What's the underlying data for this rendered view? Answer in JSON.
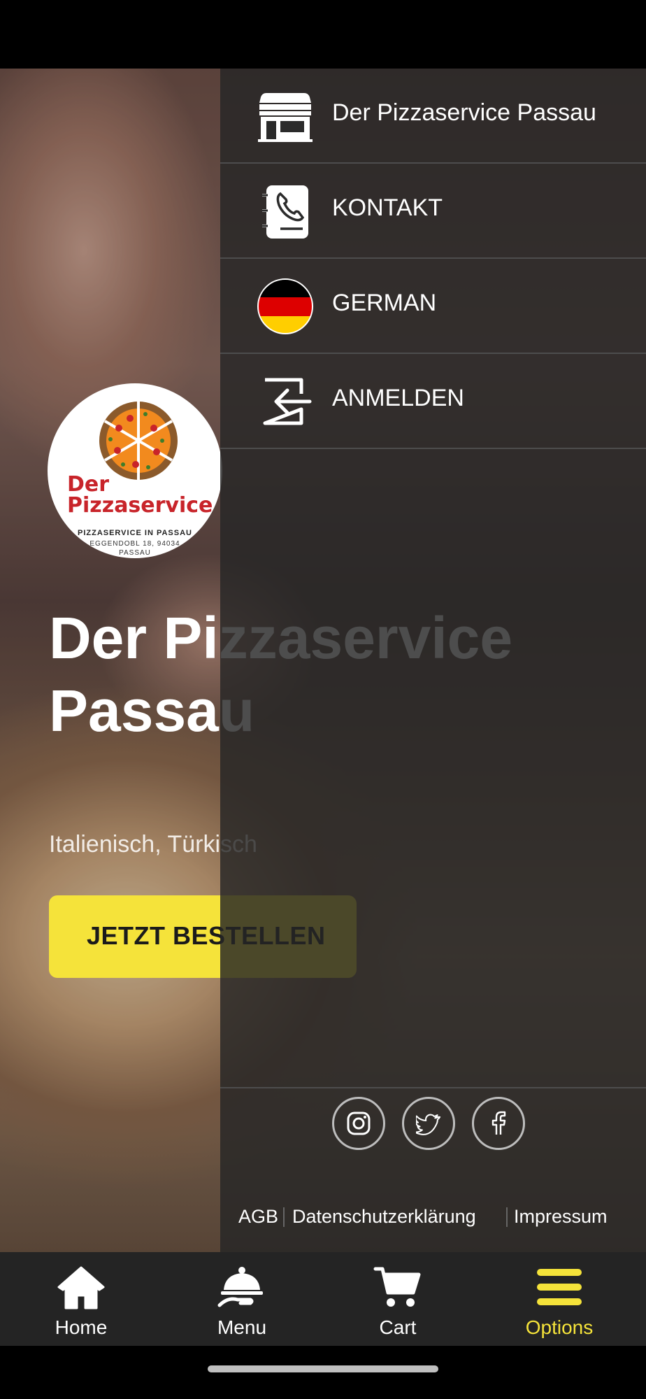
{
  "hero": {
    "logo": {
      "name_line1": "Der",
      "name_line2": "Pizzaservice",
      "tagline": "PIZZASERVICE IN PASSAU",
      "address": "EGGENDOBL 18, 94034",
      "city": "PASSAU"
    },
    "title_line1": "Der Pizzaservice",
    "title_line2": "Passau",
    "subtitle": "Italienisch, Türkisch",
    "cta_label": "JETZT BESTELLEN"
  },
  "drawer": {
    "items": [
      {
        "label": "Der Pizzaservice Passau",
        "icon": "store-icon"
      },
      {
        "label": "KONTAKT",
        "icon": "contact-book-icon"
      },
      {
        "label": "GERMAN",
        "icon": "german-flag-icon"
      },
      {
        "label": "ANMELDEN",
        "icon": "login-icon"
      }
    ],
    "social": [
      "instagram-icon",
      "twitter-icon",
      "facebook-icon"
    ],
    "legal": {
      "agb": "AGB",
      "privacy": "Datenschutzerklärung",
      "imprint": "Impressum"
    }
  },
  "bottom_nav": {
    "items": [
      {
        "label": "Home",
        "icon": "home-icon"
      },
      {
        "label": "Menu",
        "icon": "cloche-icon"
      },
      {
        "label": "Cart",
        "icon": "cart-icon"
      },
      {
        "label": "Options",
        "icon": "menu-bars-icon",
        "active": true
      }
    ]
  },
  "colors": {
    "accent": "#f5e33a",
    "drawer_bg": "#262626",
    "nav_bg": "#242424",
    "logo_red": "#c8242a"
  }
}
